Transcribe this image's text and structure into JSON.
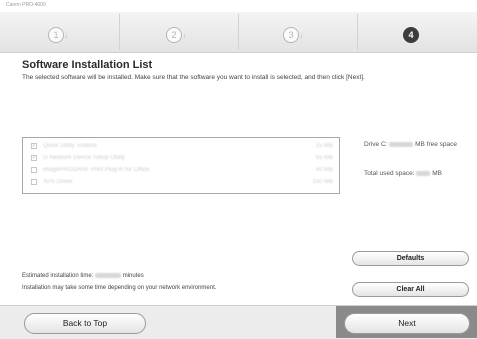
{
  "window": {
    "title": "Canon PRO-4000"
  },
  "steps": [
    {
      "label": "1"
    },
    {
      "label": "2"
    },
    {
      "label": "3"
    },
    {
      "label": "4"
    }
  ],
  "page": {
    "heading": "Software Installation List",
    "instruction": "The selected software will be installed. Make sure that the software you want to install is selected, and then click [Next]."
  },
  "software_list": [
    {
      "name": "Quick Utility Toolbox",
      "size": "25 MB",
      "checked": true
    },
    {
      "name": "IJ Network Device Setup Utility",
      "size": "65 MB",
      "checked": true
    },
    {
      "name": "imagePROGRAF Print Plug-in for Office",
      "size": "40 MB",
      "checked": false
    },
    {
      "name": "XPS Driver",
      "size": "150 MB",
      "checked": false
    }
  ],
  "disk": {
    "drive_prefix": "Drive C:",
    "drive_suffix": "MB free space",
    "used_prefix": "Total used space:",
    "used_suffix": "MB"
  },
  "footer": {
    "estimated_prefix": "Estimated installation time:",
    "estimated_suffix": "minutes",
    "network_note": "Installation may take some time depending on your network environment."
  },
  "buttons": {
    "defaults": "Defaults",
    "clear_all": "Clear All",
    "back_to_top": "Back to Top",
    "next": "Next"
  }
}
